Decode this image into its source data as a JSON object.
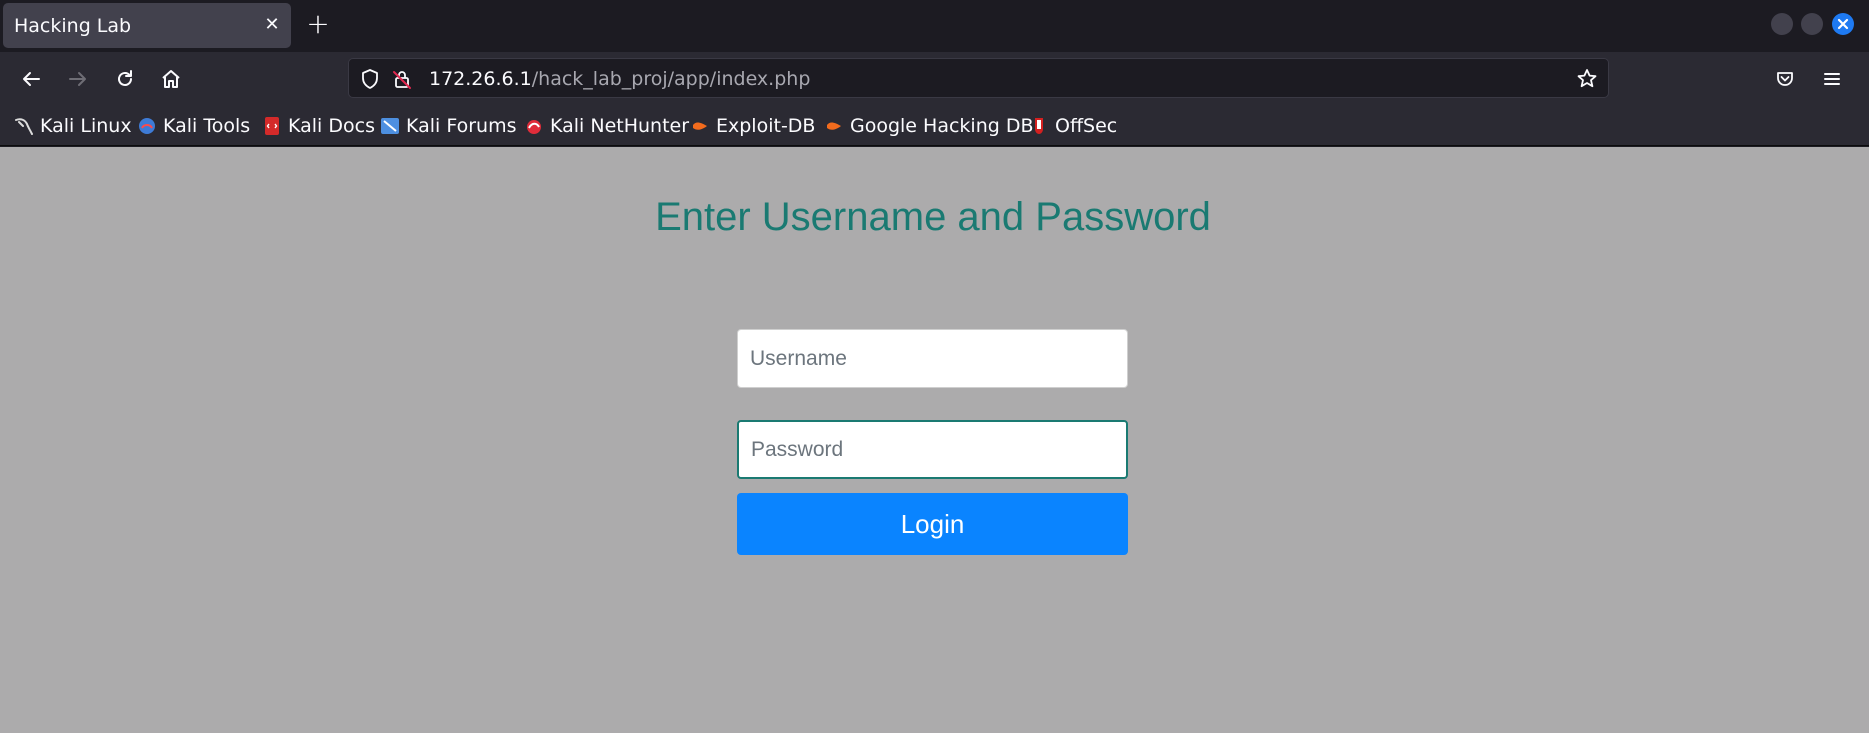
{
  "browser": {
    "tab_title": "Hacking Lab",
    "tab_close_glyph": "✕",
    "new_tab_glyph": "+",
    "url_host": "172.26.6.1",
    "url_path": "/hack_lab_proj/app/index.php"
  },
  "bookmarks": [
    {
      "label": "Kali Linux",
      "icon": "kali-dragon-icon"
    },
    {
      "label": "Kali Tools",
      "icon": "kali-tools-icon"
    },
    {
      "label": "Kali Docs",
      "icon": "kali-docs-icon"
    },
    {
      "label": "Kali Forums",
      "icon": "kali-forums-icon"
    },
    {
      "label": "Kali NetHunter",
      "icon": "nethunter-icon"
    },
    {
      "label": "Exploit-DB",
      "icon": "exploit-db-icon"
    },
    {
      "label": "Google Hacking DB",
      "icon": "ghdb-icon"
    },
    {
      "label": "OffSec",
      "icon": "offsec-icon"
    }
  ],
  "login": {
    "heading": "Enter Username and Password",
    "username_placeholder": "Username",
    "password_placeholder": "Password",
    "button_label": "Login"
  },
  "colors": {
    "heading": "#1a7a72",
    "button": "#0a84ff",
    "page_bg": "#acabac"
  }
}
